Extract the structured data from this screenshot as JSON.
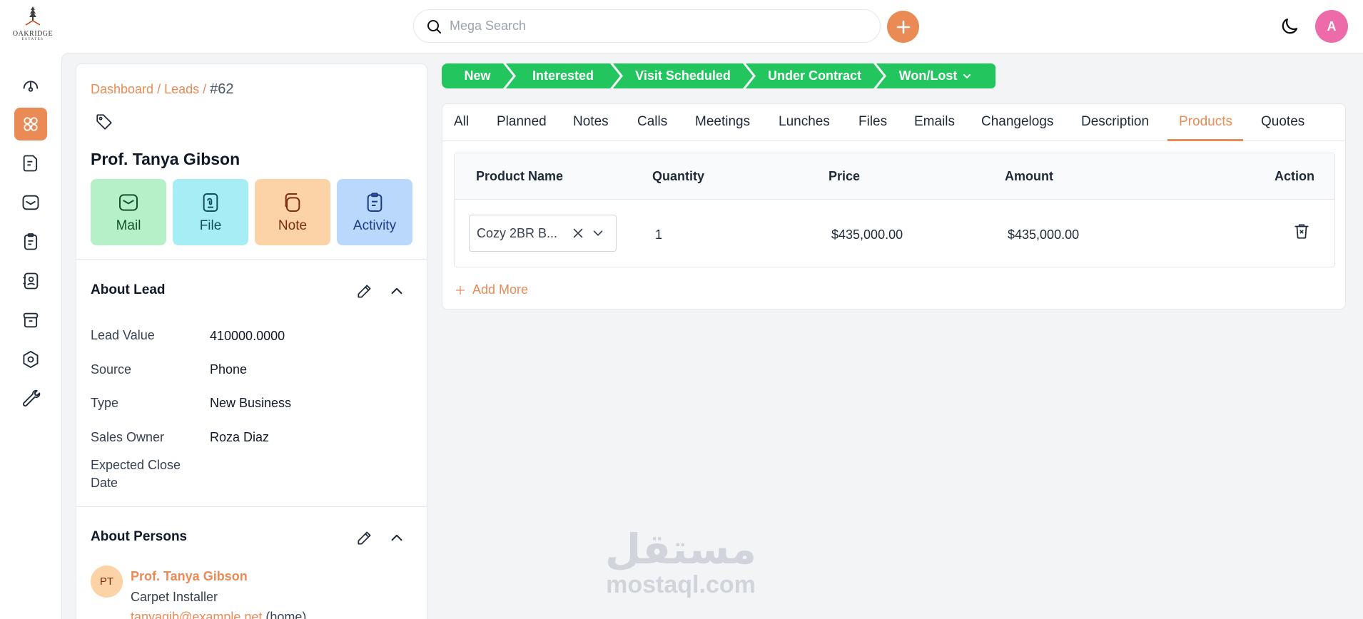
{
  "brand": {
    "name": "OAKRIDGE",
    "subtitle": "ESTATES"
  },
  "header": {
    "search_placeholder": "Mega Search",
    "avatar_initial": "A"
  },
  "breadcrumb": {
    "dashboard": "Dashboard",
    "sep1": " / ",
    "leads": "Leads",
    "sep2": " / ",
    "current": "#62"
  },
  "lead": {
    "name": "Prof. Tanya Gibson"
  },
  "actions": {
    "mail": "Mail",
    "file": "File",
    "note": "Note",
    "activity": "Activity"
  },
  "about_lead": {
    "title": "About Lead",
    "fields": [
      {
        "label": "Lead Value",
        "value": "410000.0000"
      },
      {
        "label": "Source",
        "value": "Phone"
      },
      {
        "label": "Type",
        "value": "New Business"
      },
      {
        "label": "Sales Owner",
        "value": "Roza Diaz"
      },
      {
        "label": "Expected Close Date",
        "value": ""
      }
    ]
  },
  "about_persons": {
    "title": "About Persons",
    "person": {
      "initials": "PT",
      "name": "Prof. Tanya Gibson",
      "job": "Carpet Installer",
      "email": "tanyagib@example.net",
      "email_tag": " (home)"
    }
  },
  "stages": [
    "New",
    "Interested",
    "Visit Scheduled",
    "Under Contract",
    "Won/Lost"
  ],
  "tabs": [
    "All",
    "Planned",
    "Notes",
    "Calls",
    "Meetings",
    "Lunches",
    "Files",
    "Emails",
    "Changelogs",
    "Description",
    "Products",
    "Quotes"
  ],
  "active_tab": "Products",
  "products": {
    "headers": {
      "name": "Product Name",
      "quantity": "Quantity",
      "price": "Price",
      "amount": "Amount",
      "action": "Action"
    },
    "rows": [
      {
        "name": "Cozy 2BR B...",
        "quantity": "1",
        "price": "$435,000.00",
        "amount": "$435,000.00"
      }
    ],
    "add_more": "Add More"
  },
  "watermark": {
    "arabic": "مستقل",
    "latin": "mostaql.com"
  },
  "colors": {
    "accent": "#ea8a55",
    "stage": "#22c55e",
    "avatar": "#ec6ba8"
  }
}
